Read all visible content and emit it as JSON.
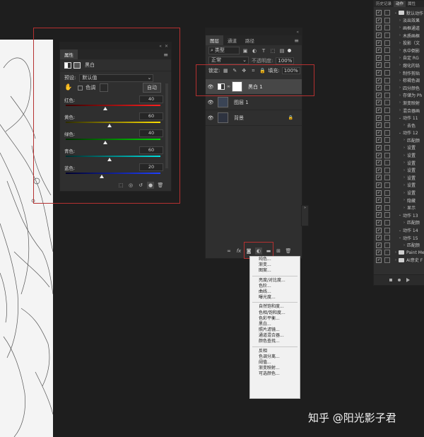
{
  "properties": {
    "title": "属性",
    "adjustment_name": "黑白",
    "preset_label": "预设:",
    "preset_value": "默认值",
    "tint_label": "色调",
    "auto_button": "自动",
    "sliders": [
      {
        "label": "红色:",
        "value": "40",
        "fraction": 0.42,
        "gradient": "linear-gradient(90deg,#3a0000,#ff2020)"
      },
      {
        "label": "黄色:",
        "value": "60",
        "fraction": 0.46,
        "gradient": "linear-gradient(90deg,#2b2b00,#ffe000)"
      },
      {
        "label": "绿色:",
        "value": "40",
        "fraction": 0.42,
        "gradient": "linear-gradient(90deg,#002b00,#00e000)"
      },
      {
        "label": "青色:",
        "value": "60",
        "fraction": 0.46,
        "gradient": "linear-gradient(90deg,#002b2b,#00e0e0)"
      },
      {
        "label": "蓝色:",
        "value": "20",
        "fraction": 0.38,
        "gradient": "linear-gradient(90deg,#00002b,#2040ff)"
      }
    ]
  },
  "layers": {
    "tabs": [
      "图层",
      "通道",
      "路径"
    ],
    "filter_kind": "类型",
    "blend_mode": "正常",
    "opacity_label": "不透明度:",
    "opacity_value": "100%",
    "lock_label": "锁定:",
    "fill_label": "填充:",
    "fill_value": "100%",
    "items": [
      {
        "name": "黑白 1"
      },
      {
        "name": "图层 1"
      },
      {
        "name": "背景"
      }
    ],
    "footer_fx": "fx"
  },
  "adjust_menu": {
    "groups": [
      [
        "纯色...",
        "渐变...",
        "图案..."
      ],
      [
        "亮度/对比度...",
        "色阶...",
        "曲线...",
        "曝光度..."
      ],
      [
        "自然饱和度...",
        "色相/饱和度...",
        "色彩平衡...",
        "黑白...",
        "照片滤镜...",
        "通道混合器...",
        "颜色查找..."
      ],
      [
        "反相",
        "色调分离...",
        "阈值...",
        "渐变映射...",
        "可选颜色..."
      ]
    ]
  },
  "actions": {
    "tabs": [
      "历史记录",
      "动作",
      "属性"
    ],
    "rows": [
      {
        "indent": 0,
        "kind": "folder",
        "label": "默认动作",
        "open": true
      },
      {
        "indent": 1,
        "kind": "item",
        "label": "淡出效果"
      },
      {
        "indent": 1,
        "kind": "item",
        "label": "画框通道"
      },
      {
        "indent": 1,
        "kind": "item",
        "label": "木质画框"
      },
      {
        "indent": 1,
        "kind": "item",
        "label": "投影（文"
      },
      {
        "indent": 1,
        "kind": "item",
        "label": "水中倒影"
      },
      {
        "indent": 1,
        "kind": "item",
        "label": "自定 RG"
      },
      {
        "indent": 1,
        "kind": "item",
        "label": "熔化的铅"
      },
      {
        "indent": 1,
        "kind": "item",
        "label": "制作剪贴"
      },
      {
        "indent": 1,
        "kind": "item",
        "label": "棕褐色调"
      },
      {
        "indent": 1,
        "kind": "item",
        "label": "四分颜色"
      },
      {
        "indent": 1,
        "kind": "item",
        "label": "存储为 Ph"
      },
      {
        "indent": 1,
        "kind": "item",
        "label": "渐变映射"
      },
      {
        "indent": 1,
        "kind": "item",
        "label": "混合器画"
      },
      {
        "indent": 1,
        "kind": "step",
        "label": "动作 11",
        "open": true
      },
      {
        "indent": 2,
        "kind": "item",
        "label": "去色"
      },
      {
        "indent": 1,
        "kind": "step",
        "label": "动作 12",
        "open": true
      },
      {
        "indent": 2,
        "kind": "item",
        "label": "匹配颜"
      },
      {
        "indent": 2,
        "kind": "item",
        "label": "设置"
      },
      {
        "indent": 2,
        "kind": "item",
        "label": "设置"
      },
      {
        "indent": 2,
        "kind": "item",
        "label": "设置"
      },
      {
        "indent": 2,
        "kind": "item",
        "label": "设置"
      },
      {
        "indent": 2,
        "kind": "item",
        "label": "设置"
      },
      {
        "indent": 2,
        "kind": "item",
        "label": "设置"
      },
      {
        "indent": 2,
        "kind": "item",
        "label": "设置"
      },
      {
        "indent": 2,
        "kind": "item",
        "label": "隐藏"
      },
      {
        "indent": 2,
        "kind": "item",
        "label": "显示"
      },
      {
        "indent": 1,
        "kind": "step",
        "label": "动作 13",
        "open": true
      },
      {
        "indent": 2,
        "kind": "item",
        "label": "匹配颜"
      },
      {
        "indent": 1,
        "kind": "step",
        "label": "动作 14",
        "open": true
      },
      {
        "indent": 1,
        "kind": "step",
        "label": "动作 15",
        "open": true
      },
      {
        "indent": 2,
        "kind": "item",
        "label": "匹配颜"
      },
      {
        "indent": 0,
        "kind": "folder",
        "label": "Paint Me"
      },
      {
        "indent": 0,
        "kind": "folder",
        "label": "AI意史 F"
      }
    ]
  },
  "watermark": "知乎 @阳光影子君"
}
